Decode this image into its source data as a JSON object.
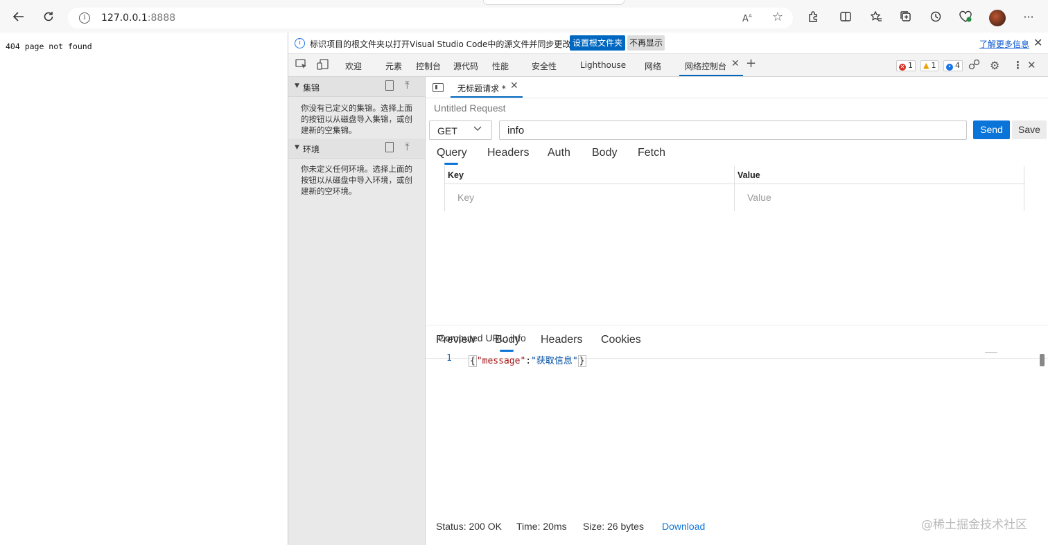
{
  "browser": {
    "url_host": "127.0.0.1",
    "url_port": ":8888",
    "read_aloud_label": "Aᴬ"
  },
  "page": {
    "text": "404 page not found"
  },
  "infobar": {
    "message": "标识项目的根文件夹以打开Visual Studio Code中的源文件并同步更改。",
    "set_root_button": "设置根文件夹",
    "dismiss_button": "不再显示",
    "learn_more_link": "了解更多信息"
  },
  "devtools_tabs": [
    "欢迎",
    "元素",
    "控制台",
    "源代码",
    "性能",
    "安全性",
    "Lighthouse",
    "网络",
    "网络控制台"
  ],
  "badges": {
    "errors": "1",
    "warnings": "1",
    "messages": "4"
  },
  "sidebar": {
    "collections_title": "集锦",
    "collections_text": "你没有已定义的集锦。选择上面的按钮以从磁盘导入集锦，或创建新的空集锦。",
    "environments_title": "环境",
    "environments_text": "你未定义任何环境。选择上面的按钮以从磁盘中导入环境，或创建新的空环境。"
  },
  "request": {
    "tab_label": "无标题请求 *",
    "title_placeholder": "Untitled Request",
    "method": "GET",
    "url": "info",
    "send": "Send",
    "save": "Save",
    "tabs": [
      "Query",
      "Headers",
      "Auth",
      "Body",
      "Fetch"
    ],
    "active_tab": "Query",
    "query_headers": {
      "key": "Key",
      "value": "Value"
    },
    "query_placeholders": {
      "key": "Key",
      "value": "Value"
    },
    "computed_url": "Computed URL: info"
  },
  "response": {
    "tabs": [
      "Preview",
      "Body",
      "Headers",
      "Cookies"
    ],
    "active_tab": "Body",
    "line_number": "1",
    "body_open": "{",
    "body_key": "\"message\"",
    "body_colon": ":",
    "body_value": "\"获取信息\"",
    "body_close": "}",
    "status": "Status: 200 OK",
    "time": "Time: 20ms",
    "size": "Size: 26 bytes",
    "download": "Download"
  },
  "watermark": "@稀土掘金技术社区",
  "colors": {
    "accent": "#0a74d9",
    "error": "#d93025",
    "warning": "#e8a100",
    "info": "#1a73e8"
  }
}
